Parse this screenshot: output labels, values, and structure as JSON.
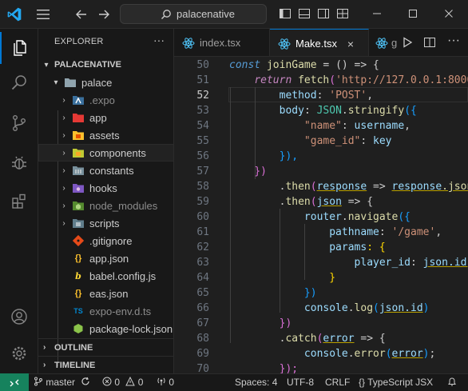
{
  "search": {
    "text": "palacenative"
  },
  "explorer": {
    "title": "EXPLORER",
    "root": "PALACENATIVE",
    "folder": "palace",
    "items": [
      {
        "label": ".expo"
      },
      {
        "label": "app"
      },
      {
        "label": "assets"
      },
      {
        "label": "components"
      },
      {
        "label": "constants"
      },
      {
        "label": "hooks"
      },
      {
        "label": "node_modules"
      },
      {
        "label": "scripts"
      },
      {
        "label": ".gitignore"
      },
      {
        "label": "app.json"
      },
      {
        "label": "babel.config.js"
      },
      {
        "label": "eas.json"
      },
      {
        "label": "expo-env.d.ts"
      },
      {
        "label": "package-lock.json"
      }
    ],
    "outline": "OUTLINE",
    "timeline": "TIMELINE"
  },
  "tabs": [
    {
      "label": "index.tsx"
    },
    {
      "label": "Make.tsx"
    },
    {
      "label": "g"
    }
  ],
  "tab_close": "×",
  "more_actions": "···",
  "editor": {
    "line_numbers": [
      "50",
      "51",
      "52",
      "53",
      "54",
      "55",
      "56",
      "57",
      "58",
      "59",
      "60",
      "61",
      "62",
      "63",
      "64",
      "65",
      "66",
      "67",
      "68",
      "69",
      "70"
    ],
    "s": {
      "const": "const",
      "joinGame": "joinGame",
      "eq": " = () => {",
      "return": "return",
      "fetch": "fetch",
      "url": "'http://127.0.0.1:8000",
      "method": "method",
      "post": "'POST'",
      "comma": ",",
      "body": "body",
      "json_obj": "JSON",
      "stringify": "stringify",
      "open_obj": "({",
      "name_key": "\"name\"",
      "username": "username",
      "gameid_key": "\"game_id\"",
      "key": "key",
      "close_obj": "}),",
      "close_paren": "})",
      "then": "then",
      "response": "response",
      "arrow": " => ",
      "response_json": ".json",
      "json": "json",
      "arrow_brace": " => {",
      "router": "router",
      "navigate": "navigate",
      "open_brace_paren": "({",
      "pathname": "pathname",
      "game_path": "'/game'",
      "params": "params",
      "colon_brace": ": {",
      "player_id": "player_id",
      "json_id": "json.id,",
      "close_brace": "}",
      "close_paren2": "})",
      "console": "console",
      "log": "log",
      "json_id2": "json.id",
      "catch": "catch",
      "error": "error",
      "err": "error",
      "close_semi": "});",
      "colon": ": "
    }
  },
  "status": {
    "remote": "><",
    "branch": "master",
    "errors": "0",
    "warnings": "0",
    "ports": "0",
    "spaces": "Spaces: 4",
    "encoding": "UTF-8",
    "eol": "CRLF",
    "language_braces": "{}",
    "language": "TypeScript JSX"
  },
  "colors": {
    "accent": "#0078d4",
    "keyword": "#569cd6",
    "control": "#c586c0",
    "function": "#dcdcaa",
    "variable": "#9cdcfe",
    "string": "#ce9178",
    "type": "#4ec9b0",
    "bracket_gold": "#ffd700",
    "bracket_pink": "#da70d6",
    "bracket_blue": "#179fff",
    "remote_bg": "#16825d"
  }
}
